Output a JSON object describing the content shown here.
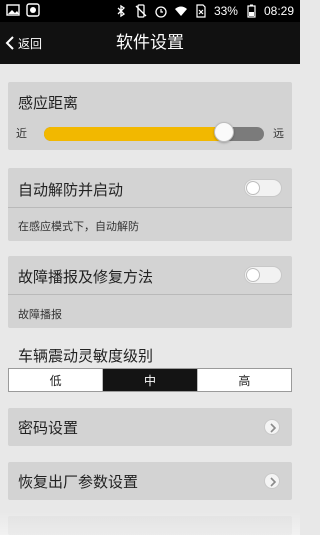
{
  "status_bar": {
    "battery": "33%",
    "time": "08:29",
    "left_icons": [
      "image-icon",
      "app-icon"
    ],
    "right_icons": [
      "bluetooth-icon",
      "mute-icon",
      "alarm-icon",
      "wifi-icon",
      "no-sim-icon",
      "battery-icon"
    ]
  },
  "nav": {
    "back_label": "返回",
    "title": "软件设置"
  },
  "sensing": {
    "title": "感应距离",
    "near_label": "近",
    "far_label": "远",
    "value_fraction": 0.82,
    "fill_color": "#f2b800"
  },
  "auto_disarm": {
    "title": "自动解防并启动",
    "description": "在感应模式下，自动解防",
    "enabled": false
  },
  "fault_report": {
    "title": "故障播报及修复方法",
    "description": "故障播报",
    "enabled": false
  },
  "vibration": {
    "label": "车辆震动灵敏度级别",
    "options": [
      "低",
      "中",
      "高"
    ],
    "selected": "中"
  },
  "menu": {
    "password": "密码设置",
    "factory_reset": "恢复出厂参数设置"
  }
}
